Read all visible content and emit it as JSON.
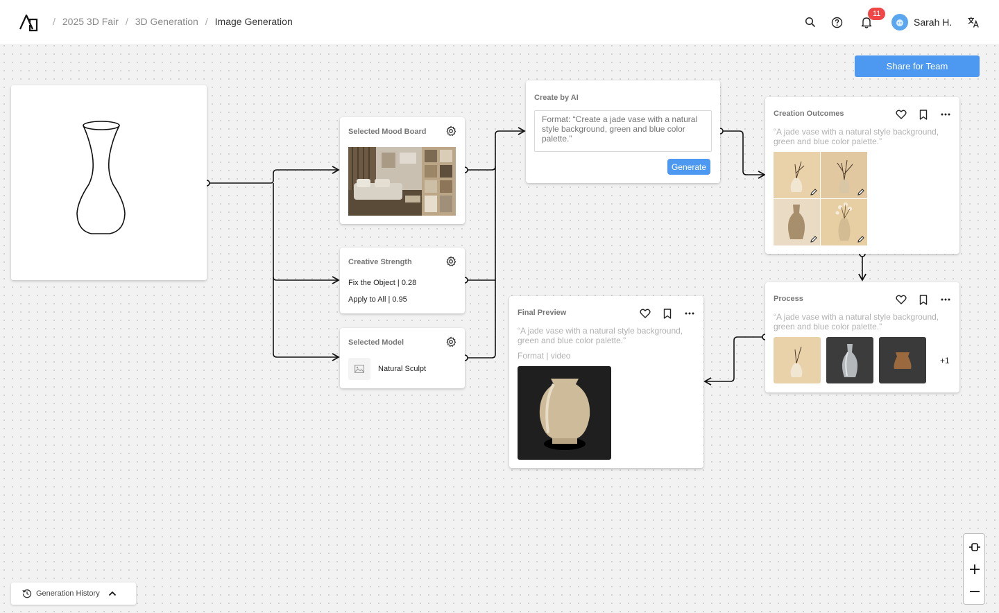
{
  "header": {
    "breadcrumb": [
      "2025 3D Fair",
      "3D Generation",
      "Image Generation"
    ],
    "notifications_count": "11",
    "user_name": "Sarah H."
  },
  "share_button": "Share for Team",
  "mood_board": {
    "title": "Selected Mood Board"
  },
  "creative_strength": {
    "title": "Creative Strength",
    "fix_object": "Fix the Object | 0.28",
    "apply_all": "Apply to All | 0.95"
  },
  "selected_model": {
    "title": "Selected Model",
    "model_name": "Natural Sculpt"
  },
  "create_ai": {
    "title": "Create by AI",
    "placeholder": "Format: “Create a jade vase with a natural style background, green and blue color palette.”",
    "generate_label": "Generate"
  },
  "outcomes": {
    "title": "Creation Outcomes",
    "prompt": "“A jade vase with a natural style background, green and blue color palette.”"
  },
  "process": {
    "title": "Process",
    "prompt": "“A jade vase with a natural style background, green and blue color palette.”",
    "more_count": "+1"
  },
  "final_preview": {
    "title": "Final Preview",
    "prompt": "“A jade vase with a natural style background, green and blue color palette.”",
    "format": "Format | video"
  },
  "history_button": "Generation History",
  "colors": {
    "accent": "#4d98f0",
    "badge": "#f04646",
    "wire": "#111111"
  }
}
